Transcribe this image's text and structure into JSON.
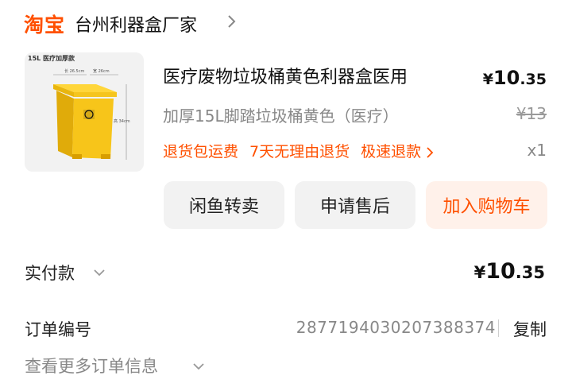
{
  "header": {
    "logo": "淘宝",
    "shop_name": "台州利器盒厂家"
  },
  "product": {
    "thumb_label": "15L 医疗加厚款",
    "dims": {
      "width": "长 26.5cm",
      "depth": "宽 26cm",
      "height": "高 34cm"
    },
    "title": "医疗废物垃圾桶黄色利器盒医用",
    "sku": "加厚15L脚踏垃圾桶黄色（医疗）",
    "price_symbol": "¥",
    "price_int": "10",
    "price_dec": ".35",
    "original_price": "¥13",
    "services": [
      "退货包运费",
      "7天无理由退货",
      "极速退款"
    ],
    "quantity": "x1"
  },
  "actions": {
    "resell": "闲鱼转卖",
    "after_sale": "申请售后",
    "add_cart": "加入购物车"
  },
  "payment": {
    "label": "实付款",
    "symbol": "¥",
    "amount_int": "10",
    "amount_dec": ".35"
  },
  "order": {
    "label": "订单编号",
    "number": "2877194030207388374",
    "copy": "复制",
    "more": "查看更多订单信息"
  },
  "colors": {
    "accent": "#ff5000",
    "bin_yellow": "#f7c51a",
    "light_orange": "#fff1ea"
  }
}
